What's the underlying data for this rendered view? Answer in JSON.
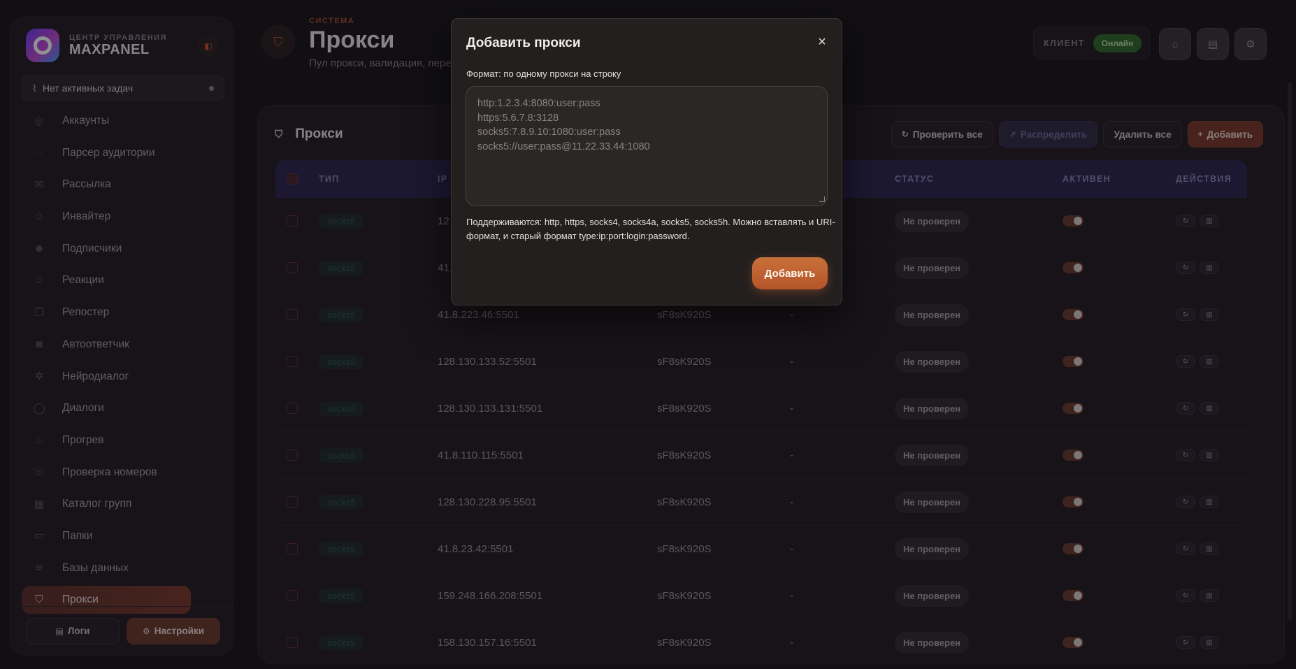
{
  "sidebar": {
    "brand_sub": "ЦЕНТР УПРАВЛЕНИЯ",
    "brand_name": "MAXPANEL",
    "tasks_text": "Нет активных задач",
    "items": [
      {
        "label": "Аккаунты",
        "icon": "user-circle-icon"
      },
      {
        "label": "Парсер аудитории",
        "icon": "target-icon"
      },
      {
        "label": "Рассылка",
        "icon": "mail-icon"
      },
      {
        "label": "Инвайтер",
        "icon": "user-plus-icon"
      },
      {
        "label": "Подписчики",
        "icon": "users-icon"
      },
      {
        "label": "Реакции",
        "icon": "smile-icon"
      },
      {
        "label": "Репостер",
        "icon": "copy-icon"
      },
      {
        "label": "Автоответчик",
        "icon": "bot-icon"
      },
      {
        "label": "Нейродиалог",
        "icon": "brain-icon"
      },
      {
        "label": "Диалоги",
        "icon": "chat-icon"
      },
      {
        "label": "Прогрев",
        "icon": "flame-icon"
      },
      {
        "label": "Проверка номеров",
        "icon": "phone-check-icon"
      },
      {
        "label": "Каталог групп",
        "icon": "grid-icon"
      },
      {
        "label": "Папки",
        "icon": "folder-icon"
      },
      {
        "label": "Базы данных",
        "icon": "database-icon"
      },
      {
        "label": "Прокси",
        "icon": "shield-icon",
        "active": true
      }
    ],
    "logs_label": "Логи",
    "settings_label": "Настройки"
  },
  "header": {
    "eyebrow": "СИСТЕМА",
    "title": "Прокси",
    "subtitle": "Пул прокси, валидация, пере",
    "client_label": "КЛИЕНТ",
    "client_status": "Онлайн"
  },
  "card": {
    "title": "Прокси",
    "actions": {
      "check_all": "Проверить все",
      "distribute": "Распределить",
      "delete_all": "Удалить все",
      "add": "Добавить"
    }
  },
  "table": {
    "columns": {
      "type": "ТИП",
      "ip": "IP",
      "status": "СТАТУС",
      "active": "АКТИВЕН",
      "actions": "ДЕЙСТВИЯ"
    },
    "rows": [
      {
        "type": "socks5",
        "ip": "12",
        "login": "",
        "pass": "",
        "status": "Не проверен",
        "active": true
      },
      {
        "type": "socks5",
        "ip": "41.",
        "login": "",
        "pass": "",
        "status": "Не проверен",
        "active": true
      },
      {
        "type": "socks5",
        "ip": "41.8.223.46:5501",
        "login": "sF8sK920S",
        "pass": "-",
        "status": "Не проверен",
        "active": true
      },
      {
        "type": "socks5",
        "ip": "128.130.133.52:5501",
        "login": "sF8sK920S",
        "pass": "-",
        "status": "Не проверен",
        "active": true
      },
      {
        "type": "socks5",
        "ip": "128.130.133.131:5501",
        "login": "sF8sK920S",
        "pass": "-",
        "status": "Не проверен",
        "active": true
      },
      {
        "type": "socks5",
        "ip": "41.8.110.115:5501",
        "login": "sF8sK920S",
        "pass": "-",
        "status": "Не проверен",
        "active": true
      },
      {
        "type": "socks5",
        "ip": "128.130.228.95:5501",
        "login": "sF8sK920S",
        "pass": "-",
        "status": "Не проверен",
        "active": true
      },
      {
        "type": "socks5",
        "ip": "41.8.23.42:5501",
        "login": "sF8sK920S",
        "pass": "-",
        "status": "Не проверен",
        "active": true
      },
      {
        "type": "socks5",
        "ip": "159.248.166.208:5501",
        "login": "sF8sK920S",
        "pass": "-",
        "status": "Не проверен",
        "active": true
      },
      {
        "type": "socks5",
        "ip": "158.130.157.16:5501",
        "login": "sF8sK920S",
        "pass": "-",
        "status": "Не проверен",
        "active": true
      }
    ]
  },
  "modal": {
    "title": "Добавить прокси",
    "format_label": "Формат: по одному прокси на строку",
    "placeholder": "http:1.2.3.4:8080:user:pass\nhttps:5.6.7.8:3128\nsocks5:7.8.9.10:1080:user:pass\nsocks5://user:pass@11.22.33.44:1080",
    "hint": "Поддерживаются: http, https, socks4, socks4a, socks5, socks5h. Можно вставлять и URI-формат, и старый формат type:ip:port:login:password.",
    "submit": "Добавить",
    "close": "×"
  },
  "colors": {
    "accent": "#c8703a",
    "online": "#2f6a2c",
    "table_header": "#2a2650"
  }
}
